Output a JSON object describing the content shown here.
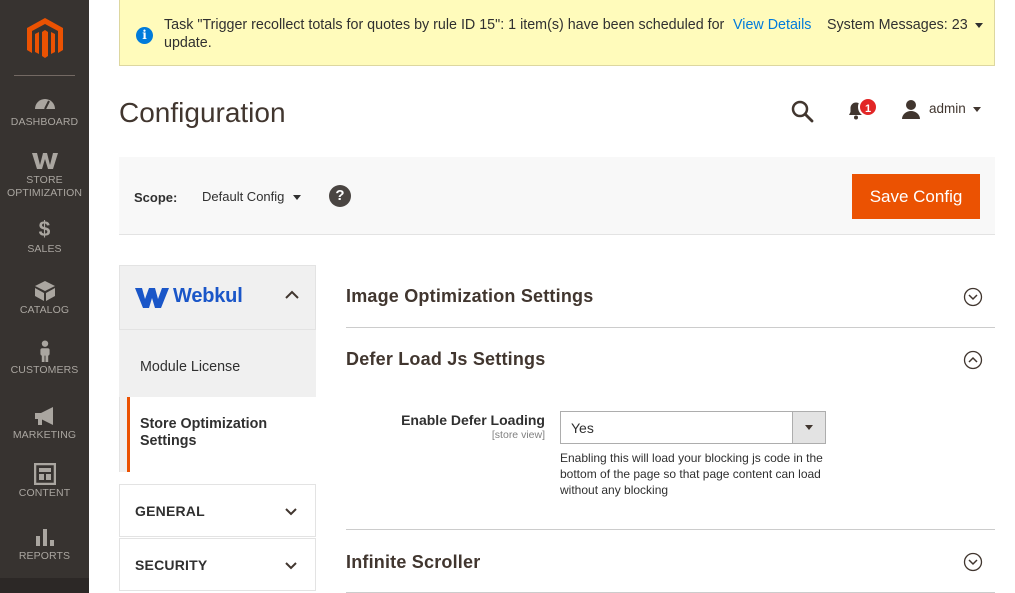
{
  "notice": {
    "text": "Task \"Trigger recollect totals for quotes by rule ID 15\": 1 item(s) have been scheduled for update.",
    "link": "View Details",
    "system_messages": "System Messages: 23",
    "icon": "info-icon"
  },
  "sidebar": {
    "items": [
      {
        "label": "DASHBOARD",
        "icon": "dashboard-icon"
      },
      {
        "label": "STORE OPTIMIZATION",
        "icon": "webkul-w-icon"
      },
      {
        "label": "SALES",
        "icon": "dollar-icon"
      },
      {
        "label": "CATALOG",
        "icon": "box-icon"
      },
      {
        "label": "CUSTOMERS",
        "icon": "person-icon"
      },
      {
        "label": "MARKETING",
        "icon": "megaphone-icon"
      },
      {
        "label": "CONTENT",
        "icon": "layout-icon"
      },
      {
        "label": "REPORTS",
        "icon": "bar-chart-icon"
      }
    ]
  },
  "header": {
    "title": "Configuration",
    "notifications_count": "1",
    "user": "admin"
  },
  "scope": {
    "label": "Scope:",
    "value": "Default Config",
    "help": "?",
    "save_label": "Save Config"
  },
  "tabs": {
    "brand": "Webkul",
    "items": [
      "Module License",
      "Store Optimization Settings"
    ],
    "groups": [
      "GENERAL",
      "SECURITY"
    ]
  },
  "sections": [
    {
      "title": "Image Optimization Settings",
      "expanded": false
    },
    {
      "title": "Defer Load Js Settings",
      "expanded": true
    },
    {
      "title": "Infinite Scroller",
      "expanded": false
    }
  ],
  "field": {
    "label": "Enable Defer Loading",
    "scope": "[store view]",
    "value": "Yes",
    "note": "Enabling this will load your blocking js code in the bottom of the page so that page content can load without any blocking"
  },
  "colors": {
    "accent": "#eb5202",
    "sidebar": "#373330",
    "link": "#007bdb",
    "notice_bg": "#fffbbb",
    "brand": "#1a56c8"
  }
}
